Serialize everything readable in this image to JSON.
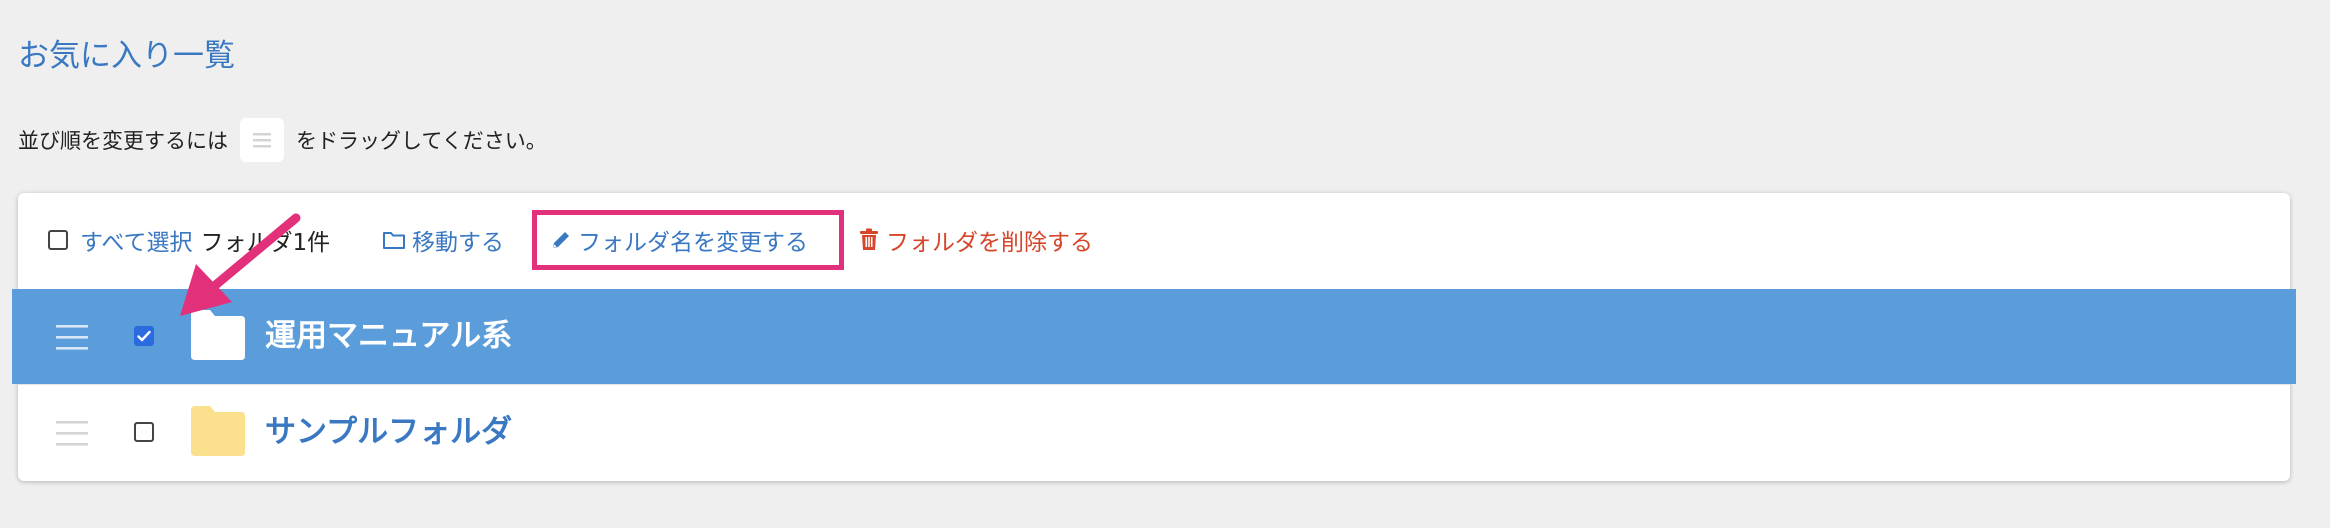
{
  "page": {
    "title": "お気に入り一覧",
    "instruction_before": "並び順を変更するには",
    "instruction_after": "をドラッグしてください。"
  },
  "toolbar": {
    "select_all": "すべて選択",
    "folder_count": "フォルダ1件",
    "move": "移動する",
    "rename": "フォルダ名を変更する",
    "delete": "フォルダを削除する"
  },
  "folders": [
    {
      "name": "運用マニュアル系",
      "checked": true,
      "selected": true
    },
    {
      "name": "サンプルフォルダ",
      "checked": false,
      "selected": false
    }
  ],
  "colors": {
    "link_blue": "#3a78c2",
    "delete_red": "#d6462b",
    "selected_row": "#5b9ddb",
    "highlight_box": "#e3307a",
    "folder_yellow": "#fbe08d",
    "checkbox_blue": "#2a6be0"
  },
  "icons": {
    "drag": "hamburger-icon",
    "move": "folder-outline-icon",
    "rename": "pencil-icon",
    "delete": "trash-icon",
    "folder": "folder-icon",
    "annotation": "arrow-icon"
  }
}
